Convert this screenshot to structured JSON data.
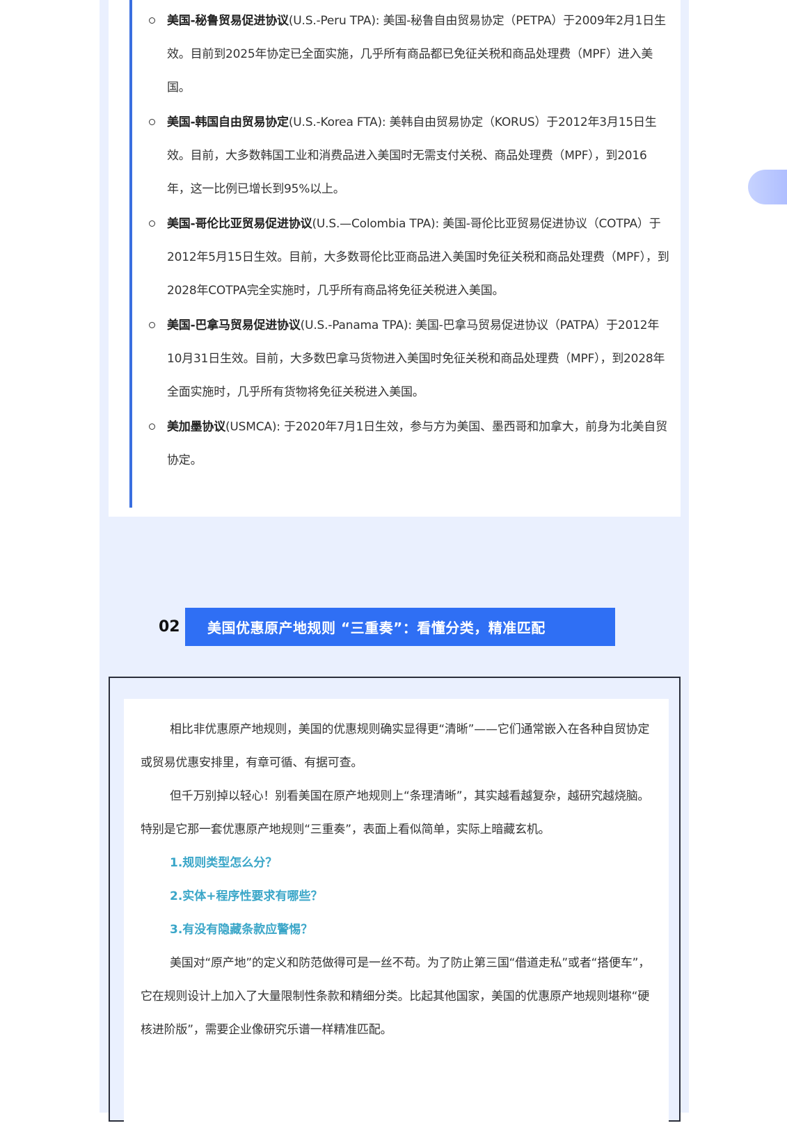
{
  "agreements": [
    {
      "name": "美国-秘鲁贸易促进协议",
      "desc": "(U.S.-Peru TPA): 美国-秘鲁自由贸易协定（PETPA）于2009年2月1日生效。目前到2025年协定已全面实施，几乎所有商品都已免征关税和商品处理费（MPF）进入美国。"
    },
    {
      "name": "美国-韩国自由贸易协定",
      "desc": "(U.S.-Korea FTA): 美韩自由贸易协定（KORUS）于2012年3月15日生效。目前，大多数韩国工业和消费品进入美国时无需支付关税、商品处理费（MPF），到2016年，这一比例已增长到95%以上。"
    },
    {
      "name": "美国-哥伦比亚贸易促进协议",
      "desc": "(U.S.—Colombia TPA): 美国-哥伦比亚贸易促进协议（COTPA）于2012年5月15日生效。目前，大多数哥伦比亚商品进入美国时免征关税和商品处理费（MPF），到2028年COTPA完全实施时，几乎所有商品将免征关税进入美国。"
    },
    {
      "name": "美国-巴拿马贸易促进协议",
      "desc": "(U.S.-Panama TPA): 美国-巴拿马贸易促进协议（PATPA）于2012年10月31日生效。目前，大多数巴拿马货物进入美国时免征关税和商品处理费（MPF），到2028年全面实施时，几乎所有货物将免征关税进入美国。"
    },
    {
      "name": "美加墨协议",
      "desc": "(USMCA): 于2020年7月1日生效，参与方为美国、墨西哥和加拿大，前身为北美自贸协定。"
    }
  ],
  "section": {
    "number": "02",
    "title": "美国优惠原产地规则 “三重奏”：看懂分类，精准匹配"
  },
  "body": {
    "para1": "相比非优惠原产地规则，美国的优惠规则确实显得更“清晰”——它们通常嵌入在各种自贸协定或贸易优惠安排里，有章可循、有据可查。",
    "para2": "但千万别掉以轻心！别看美国在原产地规则上“条理清晰”，其实越看越复杂，越研究越烧脑。特别是它那一套优惠原产地规则“三重奏”，表面上看似简单，实际上暗藏玄机。",
    "questions": [
      "1.规则类型怎么分？",
      "2.实体+程序性要求有哪些？",
      "3.有没有隐藏条款应警惕？"
    ],
    "para3": "美国对“原产地”的定义和防范做得可是一丝不苟。为了防止第三国“借道走私”或者“搭便车”，它在规则设计上加入了大量限制性条款和精细分类。比起其他国家，美国的优惠原产地规则堪称“硬核进阶版”，需要企业像研究乐谱一样精准匹配。"
  }
}
